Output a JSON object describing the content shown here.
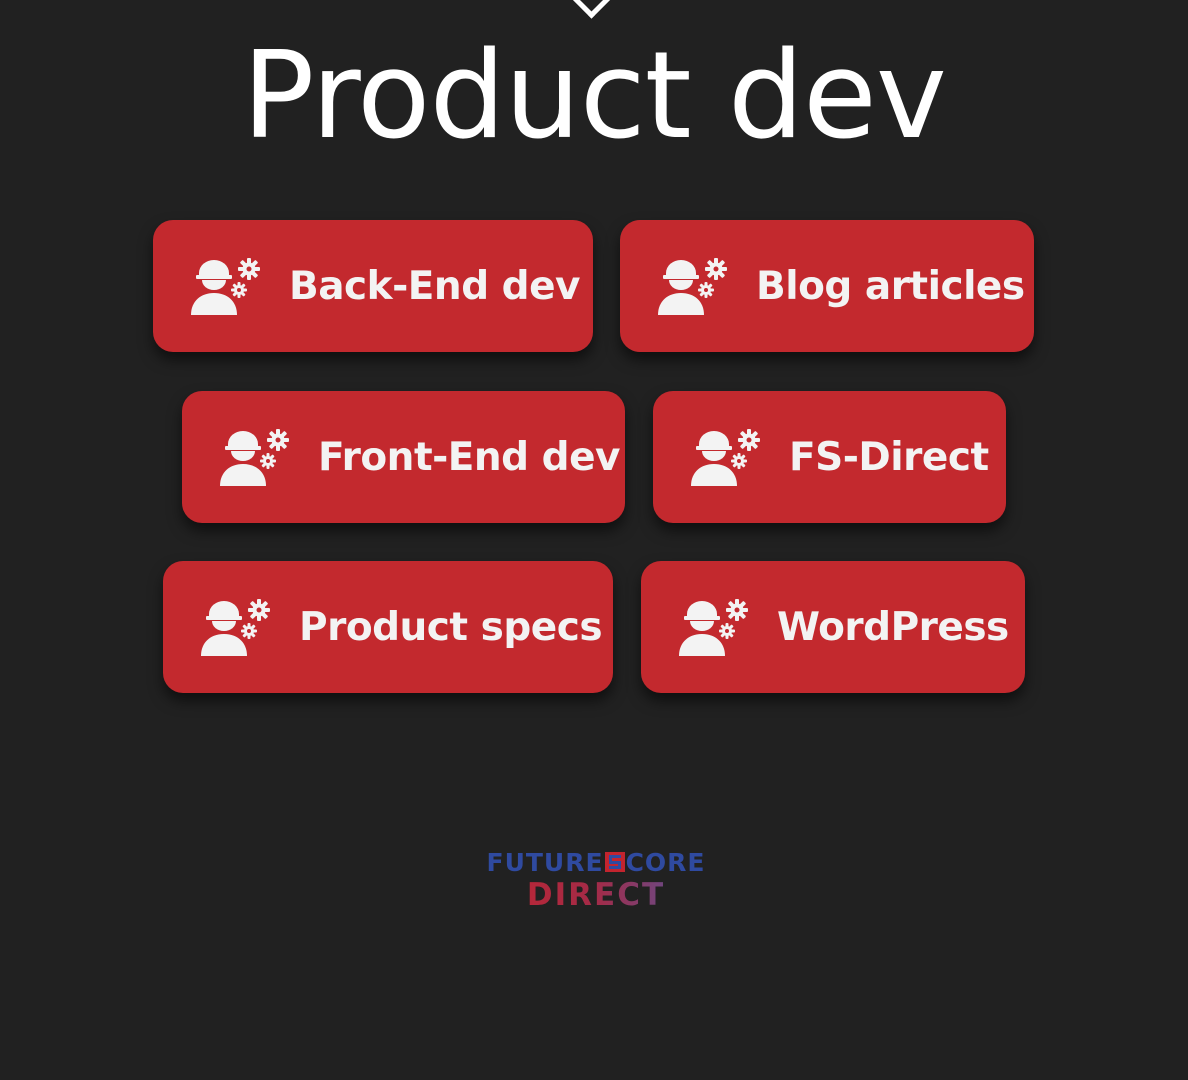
{
  "page": {
    "title": "Product dev",
    "top_icon": "chevron-down-icon"
  },
  "buttons": [
    {
      "label": "Back-End dev",
      "icon": "engineer-gears-icon"
    },
    {
      "label": "Blog articles",
      "icon": "engineer-gears-icon"
    },
    {
      "label": "Front-End dev",
      "icon": "engineer-gears-icon"
    },
    {
      "label": "FS-Direct",
      "icon": "engineer-gears-icon"
    },
    {
      "label": "Product specs",
      "icon": "engineer-gears-icon"
    },
    {
      "label": "WordPress",
      "icon": "engineer-gears-icon"
    }
  ],
  "logo": {
    "line1_part1": "FUTURE",
    "line1_part2": "CORE",
    "line2": "DIRECT"
  },
  "colors": {
    "background": "#212121",
    "button": "#c3292e",
    "text": "#ffffff",
    "logo_blue": "#2f4aa0",
    "logo_red": "#c3242e"
  }
}
